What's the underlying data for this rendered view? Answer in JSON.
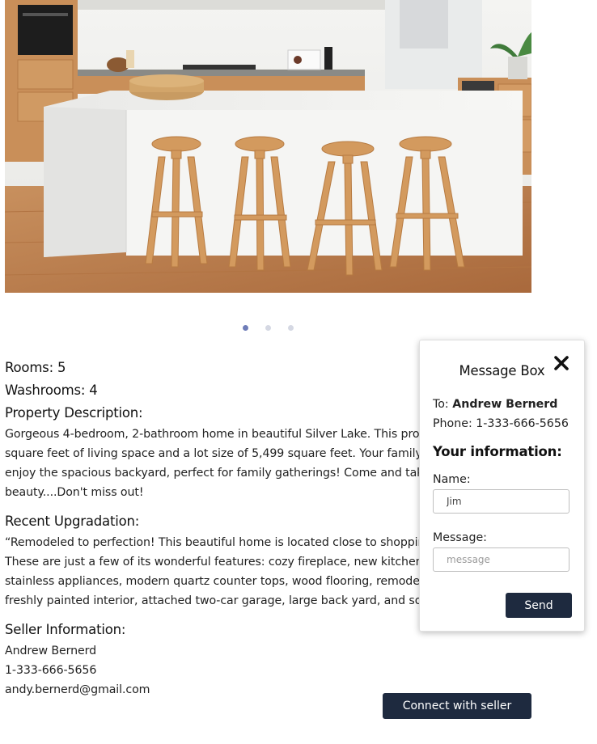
{
  "carousel": {
    "image_alt": "Modern kitchen with white island and four wooden bar stools",
    "dots": [
      {
        "active": true
      },
      {
        "active": false
      },
      {
        "active": false
      }
    ]
  },
  "property": {
    "rooms": "Rooms: 5",
    "washrooms": "Washrooms: 4",
    "description_heading": "Property Description:",
    "description": "Gorgeous 4-bedroom, 2-bathroom home in beautiful Silver Lake. This property has 2,025 square feet of living space and a lot size of 5,499 square feet. Your family and friends will enjoy the spacious backyard, perfect for family gatherings! Come and take a look at this beauty....Don't miss out!",
    "upgradation_heading": "Recent Upgradation:",
    "upgradation": "“Remodeled to perfection! This beautiful home is located close to shopping and dining. These are just a few of its wonderful features: cozy fireplace, new kitchen cabinets, stainless appliances, modern quartz counter tops, wood flooring, remodeled bathrooms, freshly painted interior, attached two-car garage, large back yard, and so much more!”",
    "seller_heading": "Seller Information:",
    "seller_name": "Andrew Bernerd",
    "seller_phone": "1-333-666-5656",
    "seller_email": "andy.bernerd@gmail.com",
    "connect_label": "Connect with seller"
  },
  "message_box": {
    "title": "Message Box",
    "to_prefix": "To: ",
    "to_name": "Andrew Bernerd",
    "phone": "Phone: 1-333-666-5656",
    "info_heading": "Your information:",
    "name_label": "Name:",
    "name_value": "Jim",
    "message_label": "Message:",
    "message_placeholder": "message",
    "send_label": "Send"
  },
  "colors": {
    "button_bg": "#1e2a3f",
    "dot_active": "#6f7db8",
    "dot_inactive": "#d5d8e3"
  }
}
